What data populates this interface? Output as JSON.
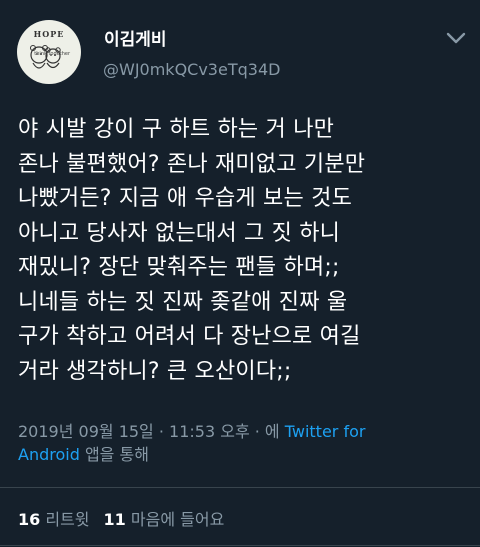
{
  "user": {
    "display_name": "이김게비",
    "handle": "@WJ0mkQCv3eTq34D",
    "avatar_text": "HOPE",
    "avatar_subtext": "think together"
  },
  "tweet": {
    "lines": [
      "야 시발 강이 구 하트 하는 거 나만",
      "존나 불편했어? 존나 재미없고 기분만",
      "나빴거든? 지금 애 우습게 보는 것도",
      "아니고 당사자 없는대서 그 짓 하니",
      "재밌니? 장단 맞춰주는 팬들 하며;;",
      "니네들 하는 짓 진짜 좆같애 진짜 울",
      "구가 착하고 어려서 다 장난으로 여길",
      "거라 생각하니? 큰 오산이다;;"
    ]
  },
  "meta": {
    "timestamp": "2019년 09월 15일 · 11:53 오후 · 에 ",
    "via_link_line1": "Twitter for",
    "via_link_line2": "Android",
    "via_suffix": " 앱을 통해"
  },
  "stats": {
    "retweets_count": "16",
    "retweets_label": "리트윗",
    "likes_count": "11",
    "likes_label": "마음에 들어요"
  },
  "icons": {
    "menu": "chevron-down-icon"
  },
  "colors": {
    "background": "#15202b",
    "secondary_text": "#8899a6",
    "link": "#1da1f2",
    "divider": "#38444d"
  }
}
